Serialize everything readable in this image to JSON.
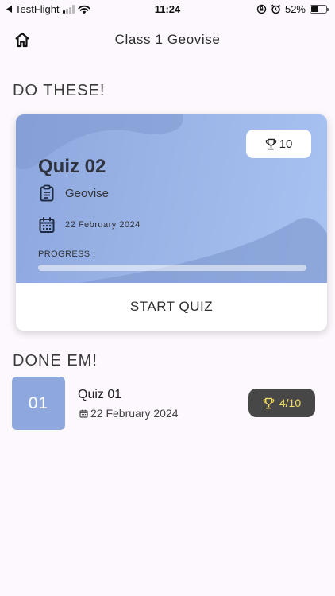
{
  "status_bar": {
    "back_app": "TestFlight",
    "time": "11:24",
    "battery_text": "52%",
    "battery_level": 0.52
  },
  "header": {
    "title": "Class 1 Geovise"
  },
  "todo": {
    "section_title": "DO THESE!",
    "quiz": {
      "title": "Quiz 02",
      "points": "10",
      "subject": "Geovise",
      "date": "22 February 2024",
      "progress_label": "PROGRESS :",
      "progress": 0,
      "start_label": "START QUIZ"
    }
  },
  "done": {
    "section_title": "DONE EM!",
    "items": [
      {
        "number": "01",
        "title": "Quiz 01",
        "date": "22 February 2024",
        "score": "4/10"
      }
    ]
  },
  "colors": {
    "accent": "#8ea8de",
    "score_text": "#f2dd62",
    "score_bg": "#474747",
    "background": "#fdf8fd"
  }
}
